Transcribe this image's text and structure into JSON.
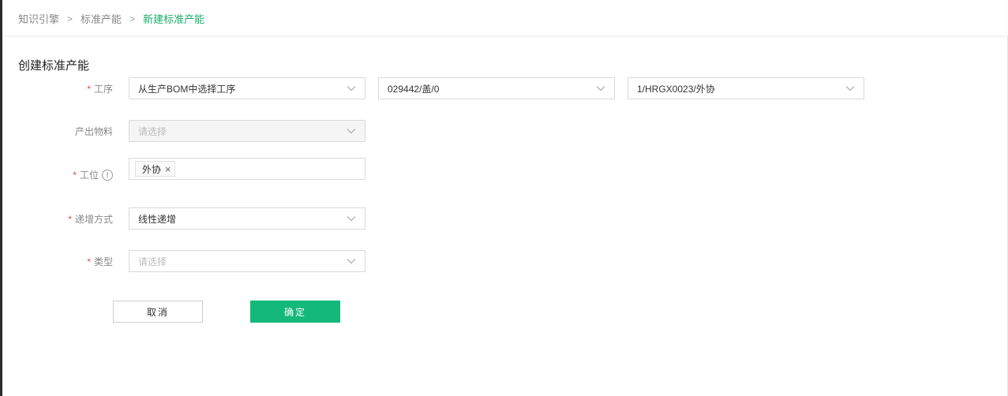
{
  "breadcrumb": {
    "items": [
      "知识引擎",
      "标准产能",
      "新建标准产能"
    ],
    "separator": ">"
  },
  "page_title": "创建标准产能",
  "form": {
    "required_mark": "*",
    "process": {
      "label": "工序",
      "select1": "从生产BOM中选择工序",
      "select2": "029442/盖/0",
      "select3": "1/HRGX0023/外协"
    },
    "output_material": {
      "label": "产出物料",
      "placeholder": "请选择"
    },
    "workstation": {
      "label": "工位",
      "info_icon": "!",
      "tags": [
        "外协"
      ],
      "tag_remove": "×"
    },
    "increment_mode": {
      "label": "递增方式",
      "value": "线性递增"
    },
    "type": {
      "label": "类型",
      "placeholder": "请选择"
    }
  },
  "buttons": {
    "cancel": "取消",
    "confirm": "确定"
  },
  "colors": {
    "accent": "#14b87b",
    "required": "#e54545",
    "breadcrumb_current": "#1aad6c"
  }
}
